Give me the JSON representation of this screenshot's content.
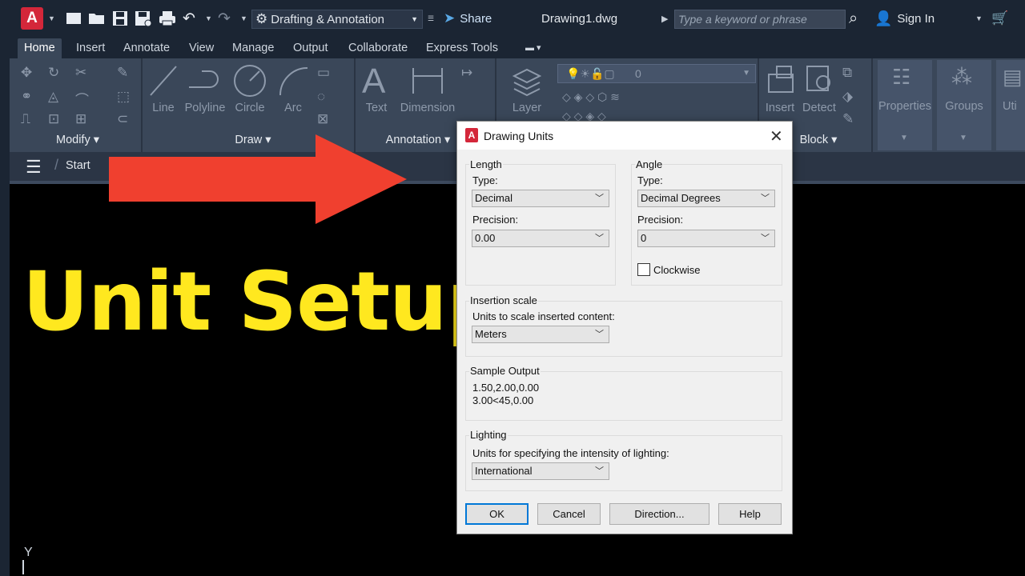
{
  "app": {
    "logo_letter": "A",
    "workspace": "Drafting & Annotation",
    "share_label": "Share",
    "document_title": "Drawing1.dwg",
    "search_placeholder": "Type a keyword or phrase",
    "sign_in_label": "Sign In"
  },
  "ribbon_tabs": [
    "Home",
    "Insert",
    "Annotate",
    "View",
    "Manage",
    "Output",
    "Collaborate",
    "Express Tools"
  ],
  "ribbon": {
    "panels": {
      "modify": "Modify",
      "draw": "Draw",
      "annotation": "Annotation",
      "block": "Block"
    },
    "tools": {
      "line": "Line",
      "polyline": "Polyline",
      "circle": "Circle",
      "arc": "Arc",
      "text": "Text",
      "dimension": "Dimension",
      "layer": "Layer",
      "insert": "Insert",
      "detect": "Detect",
      "properties": "Properties",
      "groups": "Groups",
      "utilities": "Uti"
    },
    "layer_value": "0"
  },
  "file_tabs": {
    "start": "Start"
  },
  "overlay": {
    "headline": "Unit Setup",
    "arrow_color": "#f0402f",
    "headline_color": "#ffe81f"
  },
  "dialog": {
    "title": "Drawing Units",
    "length": {
      "group_label": "Length",
      "type_label": "Type:",
      "type_value": "Decimal",
      "precision_label": "Precision:",
      "precision_value": "0.00"
    },
    "angle": {
      "group_label": "Angle",
      "type_label": "Type:",
      "type_value": "Decimal Degrees",
      "precision_label": "Precision:",
      "precision_value": "0",
      "clockwise_label": "Clockwise",
      "clockwise_checked": false
    },
    "insertion": {
      "group_label": "Insertion scale",
      "field_label": "Units to scale inserted content:",
      "value": "Meters"
    },
    "sample": {
      "group_label": "Sample Output",
      "line1": "1.50,2.00,0.00",
      "line2": "3.00<45,0.00"
    },
    "lighting": {
      "group_label": "Lighting",
      "field_label": "Units for specifying the intensity of lighting:",
      "value": "International"
    },
    "buttons": {
      "ok": "OK",
      "cancel": "Cancel",
      "direction": "Direction...",
      "help": "Help"
    }
  },
  "ucs": {
    "y_label": "Y"
  }
}
